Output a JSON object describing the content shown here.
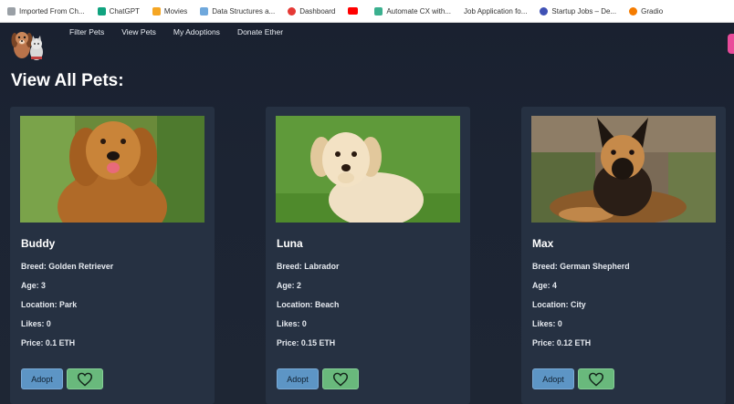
{
  "bookmarks": [
    {
      "label": "Imported From Ch...",
      "color": "#9aa0a6"
    },
    {
      "label": "ChatGPT",
      "color": "#10a37f"
    },
    {
      "label": "Movies",
      "color": "#f5a623"
    },
    {
      "label": "Data Structures a...",
      "color": "#6fa8dc"
    },
    {
      "label": "Dashboard",
      "color": "#e53935"
    },
    {
      "label": "",
      "color": "#ff0000"
    },
    {
      "label": "Automate CX with...",
      "color": "#3bb08f"
    },
    {
      "label": "Job Application fo...",
      "color": "#ffffff"
    },
    {
      "label": "Startup Jobs – De...",
      "color": "#3f51b5"
    },
    {
      "label": "Gradio",
      "color": "#f57c00"
    }
  ],
  "nav": {
    "links": [
      "Filter Pets",
      "View Pets",
      "My Adoptions",
      "Donate Ether"
    ]
  },
  "page": {
    "title": "View All Pets:"
  },
  "pets": [
    {
      "name": "Buddy",
      "breed": "Breed: Golden Retriever",
      "age": "Age: 3",
      "location": "Location: Park",
      "likes": "Likes: 0",
      "price": "Price: 0.1 ETH",
      "adopt_label": "Adopt"
    },
    {
      "name": "Luna",
      "breed": "Breed: Labrador",
      "age": "Age: 2",
      "location": "Location: Beach",
      "likes": "Likes: 0",
      "price": "Price: 0.15 ETH",
      "adopt_label": "Adopt"
    },
    {
      "name": "Max",
      "breed": "Breed: German Shepherd",
      "age": "Age: 4",
      "location": "Location: City",
      "likes": "Likes: 0",
      "price": "Price: 0.12 ETH",
      "adopt_label": "Adopt"
    }
  ],
  "colors": {
    "background": "#1c2330",
    "card": "#263142",
    "adopt_button": "#5d95c5",
    "like_button": "#69b97c",
    "accent_tab": "#e94b9a"
  }
}
